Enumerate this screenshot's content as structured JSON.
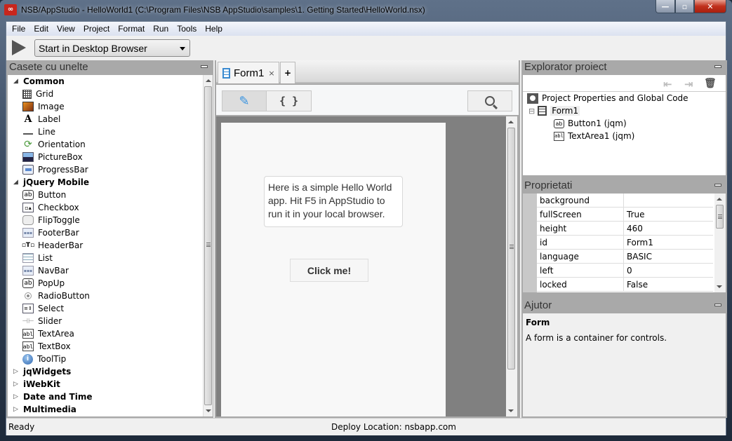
{
  "window": {
    "app_icon": "appstudio-logo-icon",
    "app_icon_text": "∞",
    "title": "NSB/AppStudio - HelloWorld1 (C:\\Program Files\\NSB AppStudio\\samples\\1. Getting Started\\HelloWorld.nsx)",
    "controls": {
      "minimize": "—",
      "maximize": "▫",
      "close": "✕"
    }
  },
  "menu": [
    "File",
    "Edit",
    "View",
    "Project",
    "Format",
    "Run",
    "Tools",
    "Help"
  ],
  "toolbar": {
    "run_icon": "play-icon",
    "run_target": "Start in Desktop Browser"
  },
  "toolbox": {
    "title": "Casete cu unelte",
    "categories": [
      {
        "name": "Common",
        "expanded": true,
        "items": [
          {
            "label": "Grid",
            "icon": "grid-icon"
          },
          {
            "label": "Image",
            "icon": "image-icon"
          },
          {
            "label": "Label",
            "icon": "label-icon",
            "glyph": "A"
          },
          {
            "label": "Line",
            "icon": "line-icon"
          },
          {
            "label": "Orientation",
            "icon": "orientation-icon",
            "glyph": "⟳"
          },
          {
            "label": "PictureBox",
            "icon": "picturebox-icon"
          },
          {
            "label": "ProgressBar",
            "icon": "progressbar-icon"
          }
        ]
      },
      {
        "name": "jQuery Mobile",
        "expanded": true,
        "items": [
          {
            "label": "Button",
            "icon": "button-icon",
            "glyph": "ab"
          },
          {
            "label": "Checkbox",
            "icon": "checkbox-icon",
            "glyph": "▫▴"
          },
          {
            "label": "FlipToggle",
            "icon": "fliptoggle-icon"
          },
          {
            "label": "FooterBar",
            "icon": "footerbar-icon",
            "glyph": "▪▪▪"
          },
          {
            "label": "HeaderBar",
            "icon": "headerbar-icon",
            "glyph": "▫T▫"
          },
          {
            "label": "List",
            "icon": "list-icon"
          },
          {
            "label": "NavBar",
            "icon": "navbar-icon",
            "glyph": "▪▪▪"
          },
          {
            "label": "PopUp",
            "icon": "popup-icon",
            "glyph": "ab"
          },
          {
            "label": "RadioButton",
            "icon": "radiobutton-icon"
          },
          {
            "label": "Select",
            "icon": "select-icon",
            "glyph": "≡⇕"
          },
          {
            "label": "Slider",
            "icon": "slider-icon",
            "glyph": "⊣⊢"
          },
          {
            "label": "TextArea",
            "icon": "textarea-icon",
            "glyph": "abl"
          },
          {
            "label": "TextBox",
            "icon": "textbox-icon",
            "glyph": "abl"
          },
          {
            "label": "ToolTip",
            "icon": "tooltip-icon",
            "glyph": "i"
          }
        ]
      },
      {
        "name": "jqWidgets",
        "expanded": false
      },
      {
        "name": "iWebKit",
        "expanded": false
      },
      {
        "name": "Date and Time",
        "expanded": false
      },
      {
        "name": "Multimedia",
        "expanded": false
      }
    ]
  },
  "designer": {
    "tabs": [
      {
        "label": "Form1",
        "close": "×",
        "active": true
      }
    ],
    "add_tab": "+",
    "design_glyph": "✎",
    "code_glyph": "{ }",
    "form": {
      "textarea_text": "Here is a simple Hello World app. Hit F5 in AppStudio to run it in your local browser.",
      "button_label": "Click me!"
    }
  },
  "explorer": {
    "title": "Explorator proiect",
    "tools": {
      "outdent": "⇤",
      "indent": "⇥",
      "delete": "🗑"
    },
    "tree": [
      {
        "label": "Project Properties and Global Code",
        "icon": "project-icon",
        "level": 0
      },
      {
        "label": "Form1",
        "icon": "form-icon",
        "level": 0,
        "expander": "⊟"
      },
      {
        "label": "Button1 (jqm)",
        "icon": "button-icon",
        "glyph": "ab",
        "level": 1
      },
      {
        "label": "TextArea1 (jqm)",
        "icon": "textarea-icon",
        "glyph": "abl",
        "level": 1
      }
    ]
  },
  "properties": {
    "title": "Proprietati",
    "rows": [
      {
        "name": "background",
        "value": ""
      },
      {
        "name": "fullScreen",
        "value": "True"
      },
      {
        "name": "height",
        "value": "460"
      },
      {
        "name": "id",
        "value": "Form1"
      },
      {
        "name": "language",
        "value": "BASIC"
      },
      {
        "name": "left",
        "value": "0"
      },
      {
        "name": "locked",
        "value": "False"
      }
    ]
  },
  "help": {
    "title": "Ajutor",
    "topic": "Form",
    "text": "A form is a container for controls."
  },
  "status": {
    "left": "Ready",
    "center": "Deploy Location: nsbapp.com"
  }
}
